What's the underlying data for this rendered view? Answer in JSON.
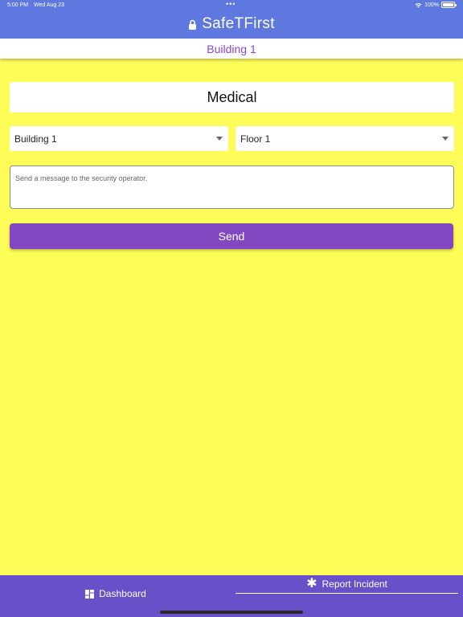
{
  "status_bar": {
    "time": "5:00 PM",
    "date": "Wed Aug 23",
    "dots": "•••",
    "battery": "100%"
  },
  "header": {
    "title": "SafeTFirst",
    "icon": "lock-icon"
  },
  "subheader": {
    "building": "Building 1"
  },
  "incident": {
    "type": "Medical"
  },
  "selects": {
    "building": "Building 1",
    "floor": "Floor 1"
  },
  "message": {
    "placeholder": "Send a message to the security operator.",
    "value": ""
  },
  "send_label": "Send",
  "tabs": [
    {
      "label": "Dashboard",
      "icon": "dashboard-icon"
    },
    {
      "label": "Report Incident",
      "icon": "asterisk-icon"
    }
  ],
  "colors": {
    "header": "#5e78df",
    "background": "#fefc58",
    "accent": "#8347c2",
    "tabbar": "#6850c9"
  }
}
